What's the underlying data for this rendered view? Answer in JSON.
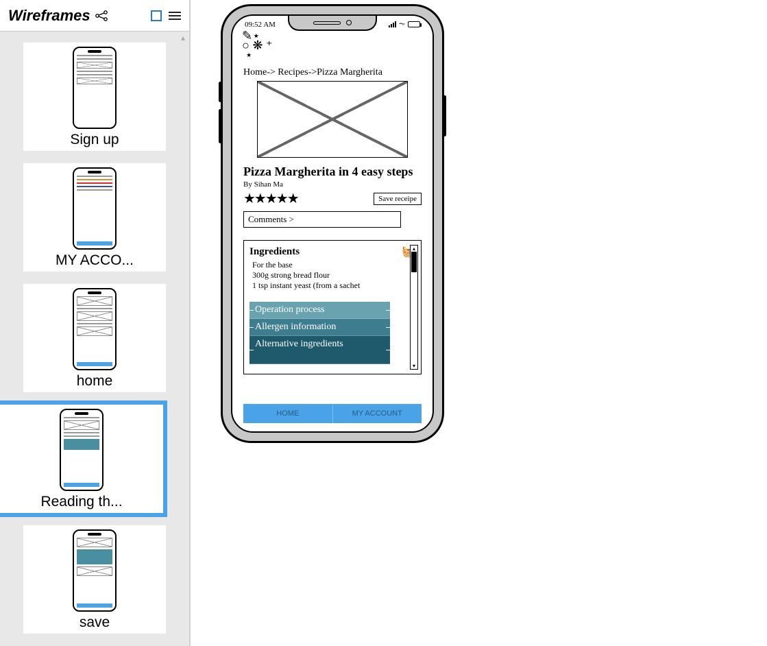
{
  "sidebar": {
    "title": "Wireframes",
    "items": [
      {
        "label": "Sign up"
      },
      {
        "label": "MY ACCO..."
      },
      {
        "label": "home"
      },
      {
        "label": "Reading th..."
      },
      {
        "label": "save"
      }
    ],
    "selected_index": 3
  },
  "phone": {
    "status_time": "09:52 AM",
    "breadcrumb": "Home-> Recipes->Pizza Margherita",
    "recipe_title": "Pizza Margherita in 4 easy steps",
    "byline": "By Sihan Ma",
    "stars": "★★★★★",
    "save_button": "Save receipe",
    "comments_button": "Comments >",
    "ingredients": {
      "title": "Ingredients",
      "lines": [
        "For the base",
        "300g strong bread flour",
        "1 tsp instant yeast (from a sachet"
      ]
    },
    "accordion": [
      "Operation process",
      "Allergen information",
      "Alternative ingredients"
    ],
    "bottom_nav": {
      "home": "HOME",
      "account": "MY ACCOUNT"
    }
  }
}
